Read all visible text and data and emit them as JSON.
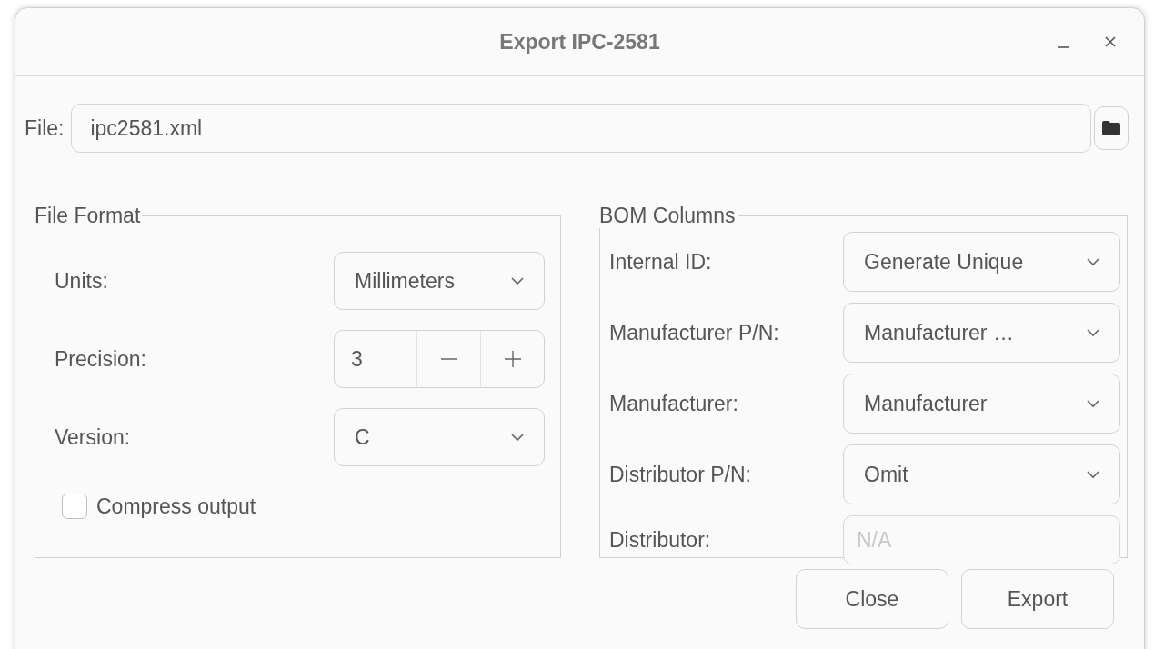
{
  "window": {
    "title": "Export IPC-2581"
  },
  "file": {
    "label": "File:",
    "value": "ipc2581.xml"
  },
  "file_format": {
    "title": "File Format",
    "fields": [
      {
        "kind": "dropdown",
        "label": "Units:",
        "value": "Millimeters"
      },
      {
        "kind": "spin",
        "label": "Precision:",
        "value": "3"
      },
      {
        "kind": "dropdown",
        "label": "Version:",
        "value": "C"
      }
    ],
    "compress_output": {
      "label": "Compress output",
      "checked": false
    }
  },
  "bom_columns": {
    "title": "BOM Columns",
    "rows": [
      {
        "kind": "dropdown",
        "label": "Internal ID:",
        "value": "Generate Unique"
      },
      {
        "kind": "dropdown",
        "label": "Manufacturer P/N:",
        "value": "Manufacturer …"
      },
      {
        "kind": "dropdown",
        "label": "Manufacturer:",
        "value": "Manufacturer"
      },
      {
        "kind": "dropdown",
        "label": "Distributor P/N:",
        "value": "Omit"
      },
      {
        "kind": "text",
        "label": "Distributor:",
        "placeholder": "N/A"
      }
    ]
  },
  "buttons": [
    "Close",
    "Export"
  ]
}
